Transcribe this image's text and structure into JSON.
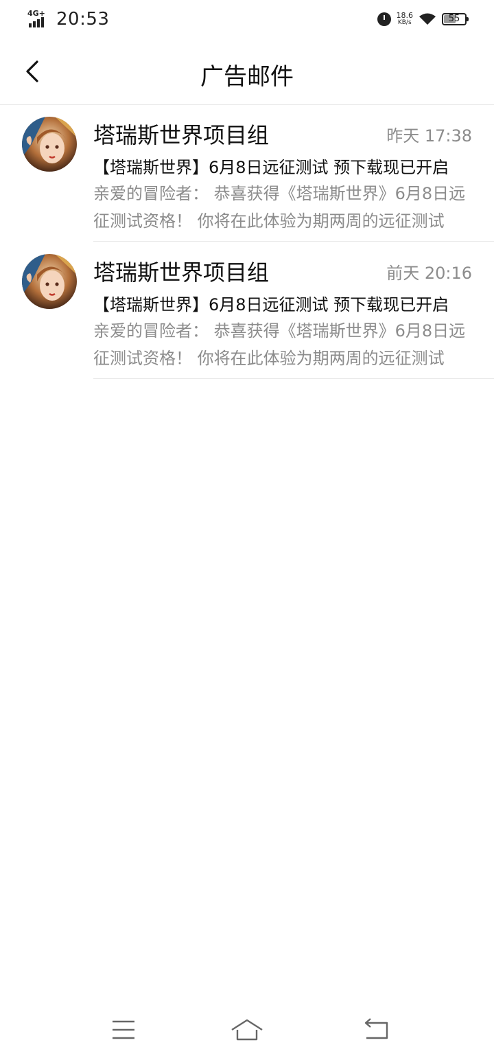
{
  "status_bar": {
    "network": "4G+",
    "time": "20:53",
    "speed_value": "18.6",
    "speed_unit": "KB/s",
    "battery": "55",
    "battery_level": 0.55
  },
  "header": {
    "title": "广告邮件",
    "back_icon": "chevron-left-icon"
  },
  "mails": [
    {
      "sender": "塔瑞斯世界项目组",
      "time": "昨天 17:38",
      "subject": "【塔瑞斯世界】6月8日远征测试 预下载现已开启",
      "preview": "亲爱的冒险者：   恭喜获得《塔瑞斯世界》6月8日远征测试资格！   你将在此体验为期两周的远征测试"
    },
    {
      "sender": "塔瑞斯世界项目组",
      "time": "前天 20:16",
      "subject": "【塔瑞斯世界】6月8日远征测试 预下载现已开启",
      "preview": "亲爱的冒险者：   恭喜获得《塔瑞斯世界》6月8日远征测试资格！   你将在此体验为期两周的远征测试"
    }
  ],
  "nav_bar": {
    "menu_icon": "menu-icon",
    "home_icon": "home-icon",
    "back_icon": "back-icon"
  },
  "colors": {
    "text_primary": "#111111",
    "text_secondary": "#8c8c8c",
    "divider": "#e8e8e8"
  }
}
